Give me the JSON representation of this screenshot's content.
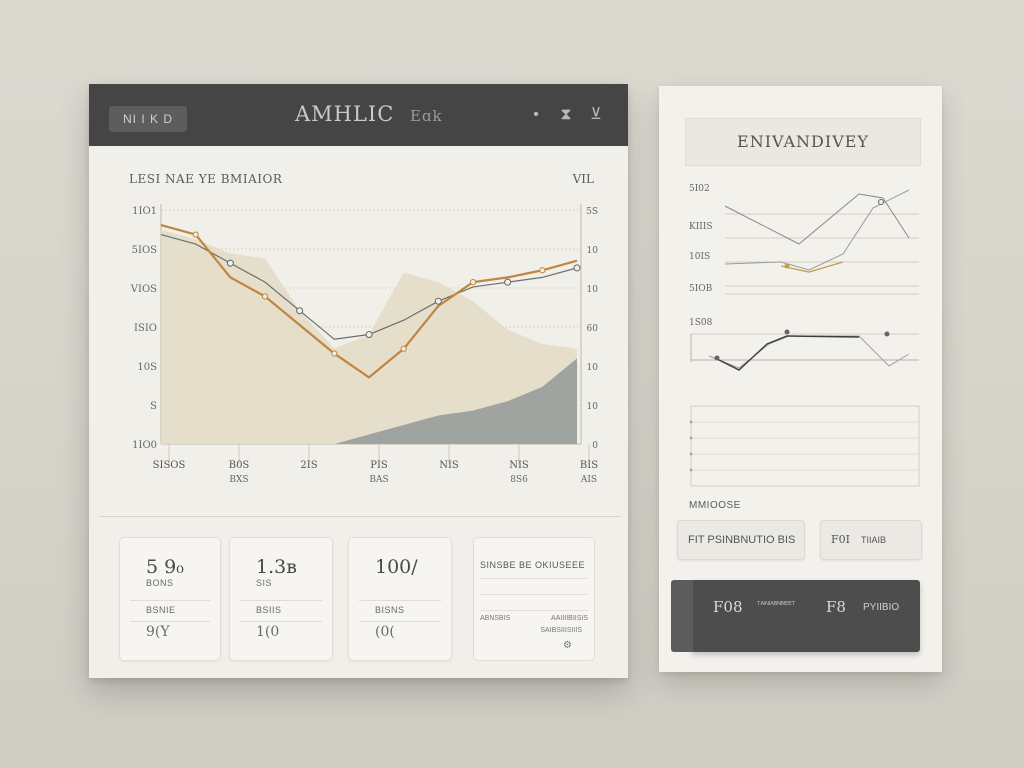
{
  "header": {
    "chip_label": "NI I K D",
    "title": "AMHLIC",
    "title_suffix": "Eɑk",
    "icons": [
      "dot-icon",
      "hourglass-icon",
      "bookmark-icon"
    ]
  },
  "main_chart": {
    "title": "LESI NAE YE BMIAIOR",
    "corner_label": "VIL"
  },
  "chart_data": {
    "type": "area",
    "title": "LESI NAE YE BMIAIOR",
    "y_tick_labels_left": [
      "1IO1",
      "5IOS",
      "VIOS",
      "ISIO",
      "10S",
      "S",
      "1IO0"
    ],
    "y_tick_labels_right": [
      "5S",
      "10",
      "10",
      "60",
      "10",
      "10",
      "0"
    ],
    "x_tick_labels": [
      "SISOS",
      "B0S",
      "2IS",
      "PIS",
      "NIS",
      "NIS",
      "BIS"
    ],
    "x_tick_sublabels": [
      "",
      "BXS",
      "",
      "BAS",
      "",
      "8S6",
      "AIS"
    ],
    "series": [
      {
        "values": [
          92,
          88,
          70,
          62,
          50,
          38,
          28,
          40,
          58,
          68,
          70,
          73,
          77
        ]
      },
      {
        "values": [
          88,
          84,
          76,
          68,
          56,
          44,
          46,
          52,
          60,
          66,
          68,
          70,
          74
        ]
      },
      {
        "values": [
          90,
          86,
          80,
          78,
          56,
          40,
          46,
          72,
          68,
          60,
          48,
          42,
          40
        ]
      },
      {
        "values": [
          0,
          0,
          0,
          0,
          0,
          0,
          4,
          8,
          12,
          14,
          18,
          24,
          36
        ]
      }
    ],
    "ylim": [
      0,
      100
    ],
    "colors": [
      "#c2853f",
      "#6e6e6e",
      "#e4dcc8",
      "#8d9596"
    ]
  },
  "cards": [
    {
      "big": "5 9₀",
      "sub": "BONS",
      "label": "BSNIE",
      "foot": "9(Y"
    },
    {
      "big": "1.3ʙ",
      "sub": "SIS",
      "label": "BSIIS",
      "foot": "1(0"
    },
    {
      "big": "100/",
      "sub": "",
      "label": "BISNS",
      "foot": "(0("
    }
  ],
  "summary_card": {
    "title": "SINSBE BE OKIUSEEE",
    "t1": "ABNSBIS",
    "t2": "AAIIIIBIISIS",
    "t3": "SAIBSIIISIIIS"
  },
  "right_panel": {
    "title": "ENIVANDIVEY",
    "chart_labels": [
      "5I02",
      "KIIIS",
      "10IS",
      "5IOB",
      "1S08"
    ],
    "mid_label": "MMIOOSE",
    "button1": "FIT PSINBNUTIO BIS",
    "button2_a": "F0I",
    "button2_b": "TIIAIB",
    "dark_a": "F08",
    "dark_b": "ᵀᴬᴵᴺᴵᴬᴮᴺᴮᴵᴱᴱᵀ",
    "dark_c": "F8",
    "dark_d": "PYIIBIO"
  }
}
